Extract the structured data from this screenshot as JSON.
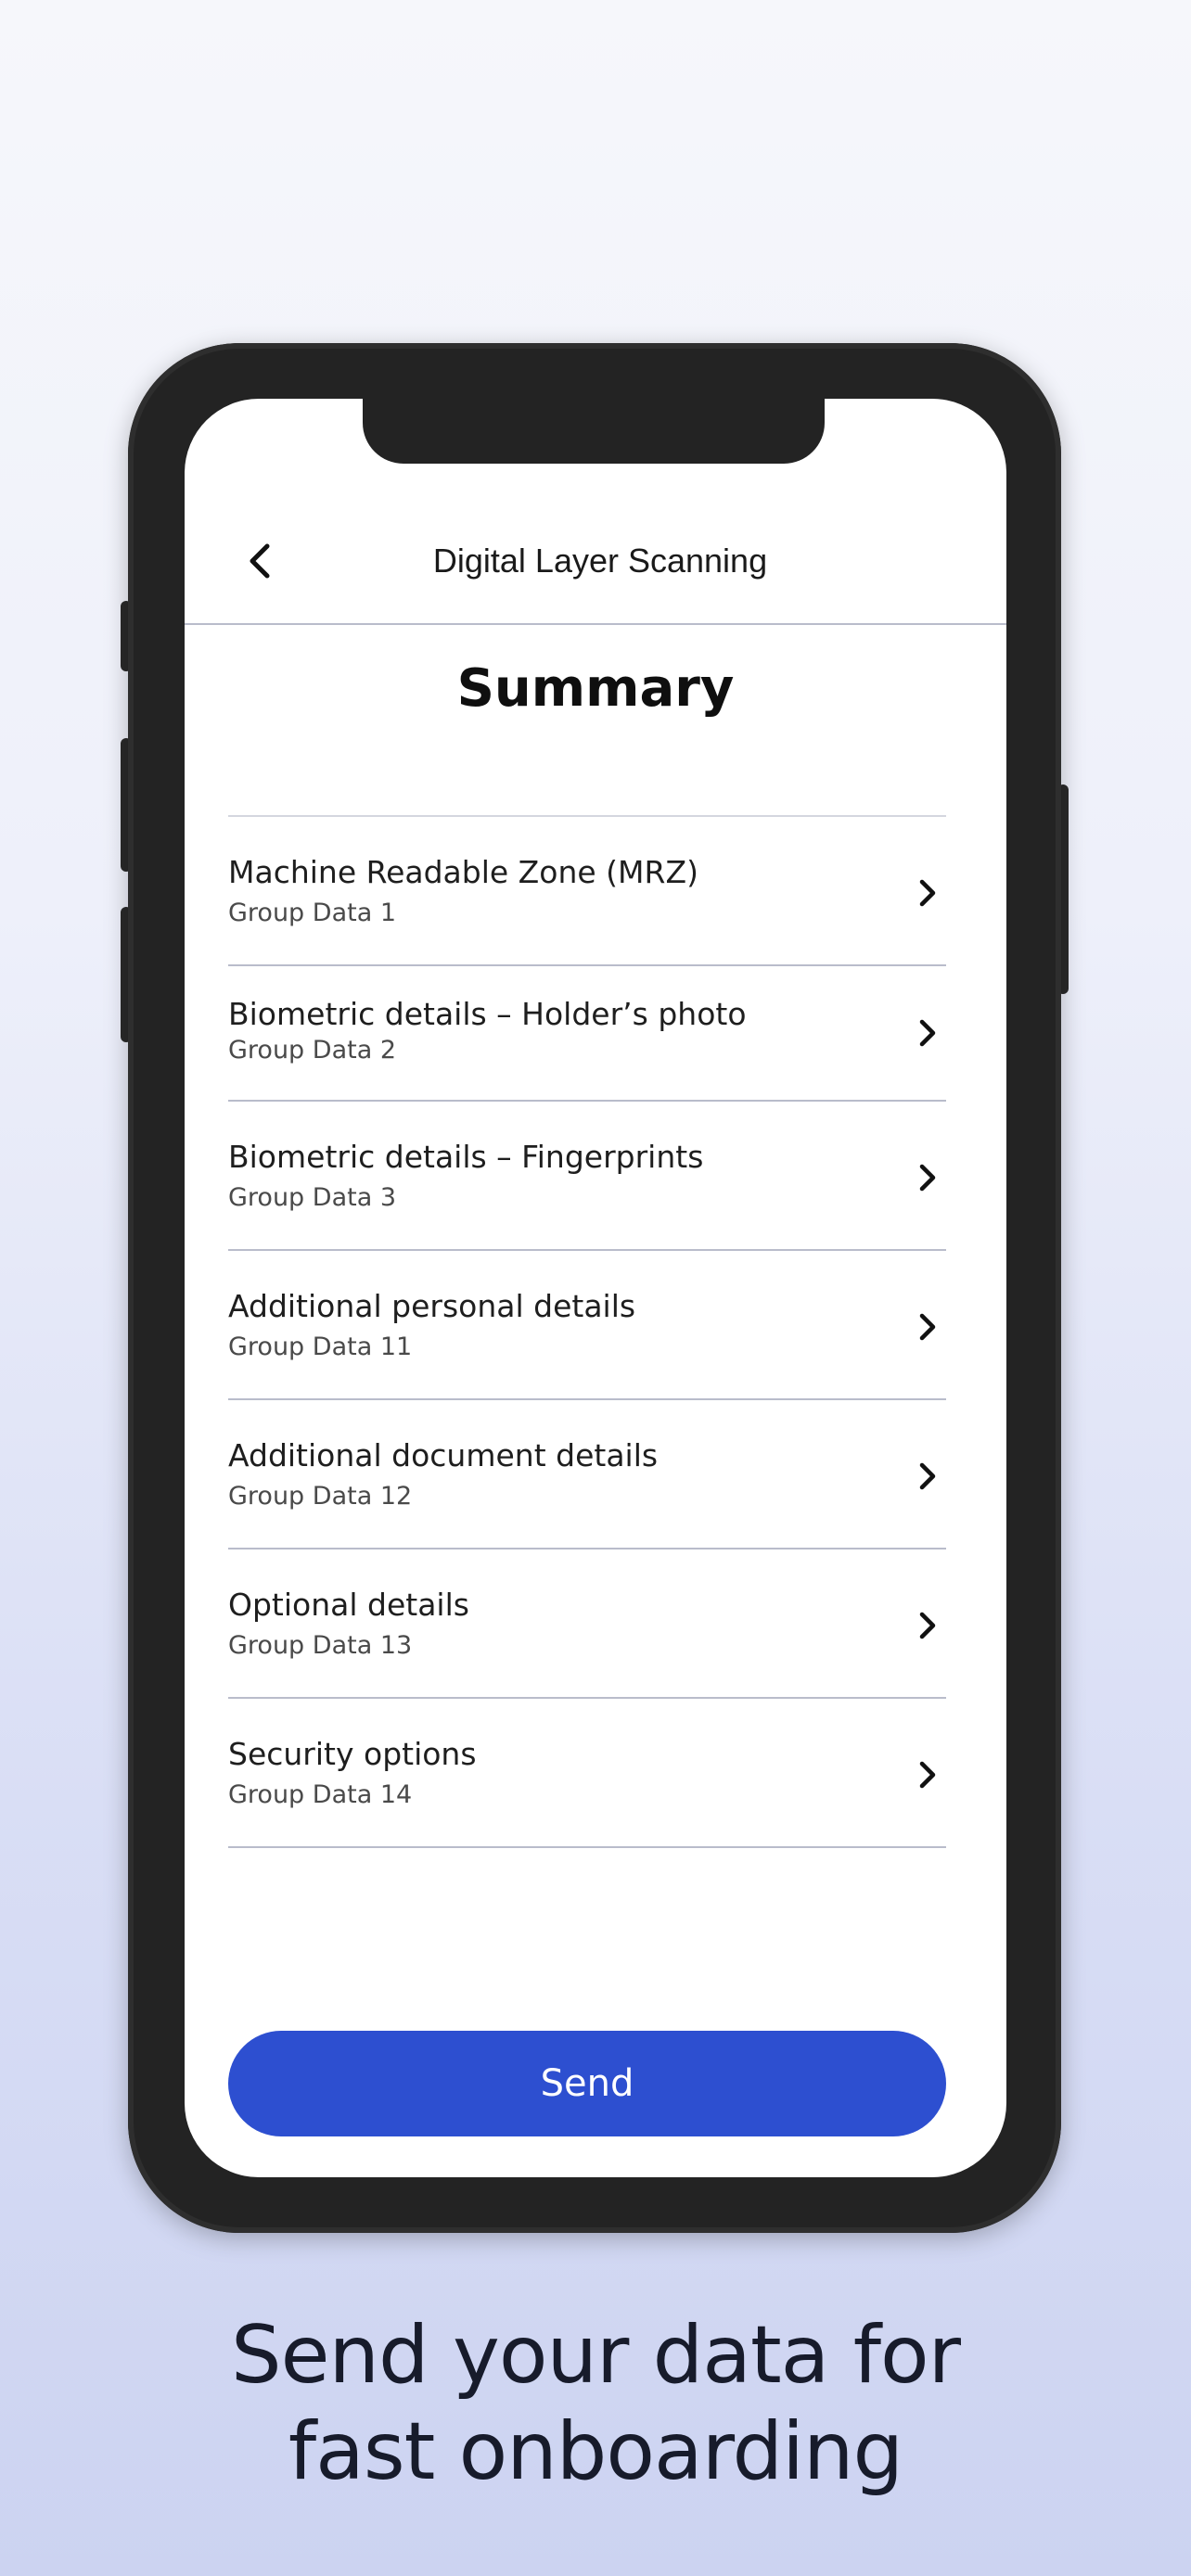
{
  "header": {
    "back_icon": "chevron-left-icon",
    "title": "Digital Layer Scanning"
  },
  "summary": {
    "title": "Summary"
  },
  "list": {
    "items": [
      {
        "title": "Machine Readable Zone (MRZ)",
        "subtitle": "Group Data 1"
      },
      {
        "title": "Biometric details – Holder’s photo",
        "subtitle": "Group Data 2"
      },
      {
        "title": "Biometric details – Fingerprints",
        "subtitle": "Group Data 3"
      },
      {
        "title": "Additional personal details",
        "subtitle": "Group Data 11"
      },
      {
        "title": "Additional document details",
        "subtitle": "Group Data 12"
      },
      {
        "title": "Optional details",
        "subtitle": "Group Data 13"
      },
      {
        "title": "Security options",
        "subtitle": "Group Data 14"
      }
    ],
    "chevron_icon": "chevron-right-icon"
  },
  "send_button": {
    "label": "Send"
  },
  "tagline": {
    "line1": "Send your data for",
    "line2": "fast onboarding"
  },
  "colors": {
    "accent": "#2d4fd0",
    "phone_frame": "#232323",
    "background_top": "#f6f7fb",
    "background_bottom": "#ccd3f1"
  }
}
